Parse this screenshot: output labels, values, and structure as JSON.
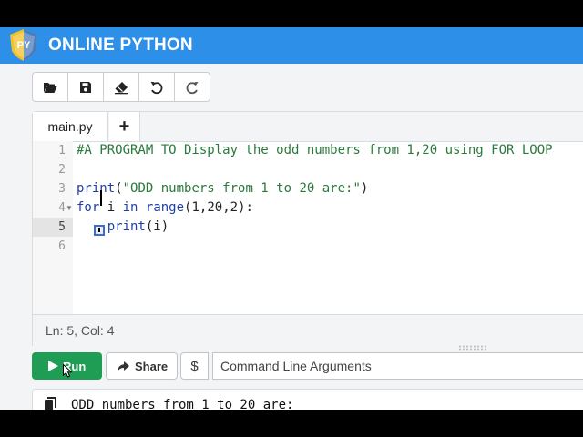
{
  "app": {
    "brand": "ONLINE PYTHON",
    "logo_text": "PY",
    "accent": "#2e8fe8"
  },
  "toolbar": {
    "buttons": [
      {
        "name": "open-file",
        "icon": "folder-open-icon"
      },
      {
        "name": "save",
        "icon": "save-icon"
      },
      {
        "name": "erase",
        "icon": "eraser-icon"
      },
      {
        "name": "undo",
        "icon": "undo-icon"
      },
      {
        "name": "redo",
        "icon": "redo-icon"
      }
    ]
  },
  "tabs": {
    "active": "main.py",
    "add": "+"
  },
  "editor": {
    "line_numbers": [
      "1",
      "2",
      "3",
      "4",
      "5",
      "6"
    ],
    "active_line": "5",
    "lines": [
      [
        {
          "t": "#A PROGRAM TO Display the odd numbers from 1,20 using FOR LOOP",
          "c": "comment"
        }
      ],
      [],
      [
        {
          "t": "print",
          "c": "kw"
        },
        {
          "t": "(",
          "c": "plain"
        },
        {
          "t": "\"ODD numbers from 1 to 20 are:\"",
          "c": "str"
        },
        {
          "t": ")",
          "c": "plain"
        }
      ],
      [
        {
          "t": "for",
          "c": "kw"
        },
        {
          "t": " i ",
          "c": "plain"
        },
        {
          "t": "in",
          "c": "kw"
        },
        {
          "t": " ",
          "c": "plain"
        },
        {
          "t": "range",
          "c": "kw"
        },
        {
          "t": "(",
          "c": "plain"
        },
        {
          "t": "1",
          "c": "num"
        },
        {
          "t": ",",
          "c": "plain"
        },
        {
          "t": "20",
          "c": "num"
        },
        {
          "t": ",",
          "c": "plain"
        },
        {
          "t": "2",
          "c": "num"
        },
        {
          "t": "):",
          "c": "plain"
        }
      ],
      [
        {
          "t": "    ",
          "c": "plain"
        },
        {
          "t": "print",
          "c": "kw"
        },
        {
          "t": "(i)",
          "c": "plain"
        }
      ],
      []
    ],
    "status": "Ln: 5,  Col: 4"
  },
  "runbar": {
    "run_label": "Run",
    "share_label": "Share",
    "args_prefix": "$",
    "args_placeholder": "Command Line Arguments",
    "run_color": "#1f9d55"
  },
  "output": {
    "text": "ODD numbers from 1 to 20 are:"
  }
}
